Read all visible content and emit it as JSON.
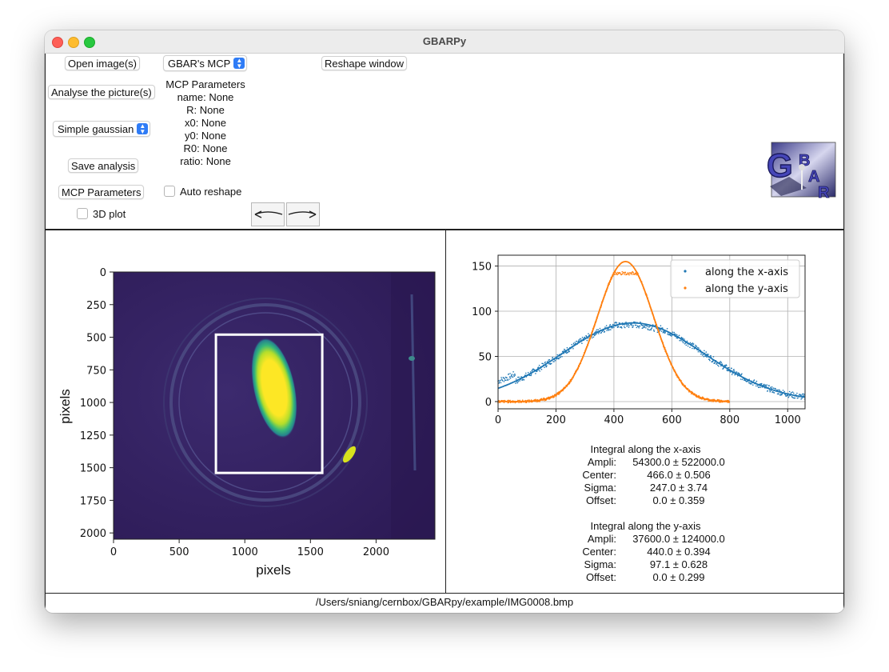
{
  "window": {
    "title": "GBARPy"
  },
  "controls": {
    "open_images": "Open image(s)",
    "analyse": "Analyse the picture(s)",
    "fit_mode": "Simple gaussian",
    "save_analysis": "Save analysis",
    "mcp_parameters": "MCP Parameters",
    "plot_3d": "3D plot",
    "mcp_select": "GBAR's MCP",
    "auto_reshape": "Auto reshape",
    "reshape_window": "Reshape window"
  },
  "mcp_params": {
    "title": "MCP Parameters",
    "lines": [
      "name: None",
      "R: None",
      "x0: None",
      "y0: None",
      "R0: None",
      "ratio: None"
    ]
  },
  "logo": {
    "letters": [
      "G",
      "B",
      "A",
      "R"
    ]
  },
  "image_plot": {
    "xlabel": "pixels",
    "ylabel": "pixels",
    "xticks": [
      "0",
      "500",
      "1000",
      "1500",
      "2000"
    ],
    "yticks": [
      "0",
      "250",
      "500",
      "750",
      "1000",
      "1250",
      "1500",
      "1750",
      "2000"
    ],
    "colormap": "viridis",
    "roi_rectangle": {
      "x_range": [
        780,
        1590
      ],
      "y_range": [
        480,
        1540
      ],
      "color": "#ffffff"
    }
  },
  "chart_data": {
    "type": "scatter",
    "xlim": [
      0,
      1060
    ],
    "ylim": [
      -8,
      162
    ],
    "xticks": [
      0,
      200,
      400,
      600,
      800,
      1000
    ],
    "yticks": [
      0,
      50,
      100,
      150
    ],
    "grid": true,
    "legend_position": "top-right",
    "series": [
      {
        "name": "along the x-axis",
        "color": "#1f77b4",
        "x_range": [
          0,
          1060
        ],
        "amplitude": 87,
        "center": 466,
        "sigma": 247,
        "offset": 0
      },
      {
        "name": "along the y-axis",
        "color": "#ff7f0e",
        "x_range": [
          0,
          800
        ],
        "amplitude": 155,
        "center": 440,
        "sigma": 97.1,
        "offset": 0
      }
    ]
  },
  "results": {
    "x": {
      "title": "Integral along the x-axis",
      "rows": [
        {
          "label": "Ampli:",
          "value": "54300.0 ± 522000.0"
        },
        {
          "label": "Center:",
          "value": "466.0 ± 0.506"
        },
        {
          "label": "Sigma:",
          "value": "247.0 ± 3.74"
        },
        {
          "label": "Offset:",
          "value": "0.0 ± 0.359"
        }
      ]
    },
    "y": {
      "title": "Integral along the y-axis",
      "rows": [
        {
          "label": "Ampli:",
          "value": "37600.0 ± 124000.0"
        },
        {
          "label": "Center:",
          "value": "440.0 ± 0.394"
        },
        {
          "label": "Sigma:",
          "value": "97.1 ± 0.628"
        },
        {
          "label": "Offset:",
          "value": "0.0 ± 0.299"
        }
      ]
    }
  },
  "status": {
    "path": "/Users/sniang/cernbox/GBARpy/example/IMG0008.bmp"
  }
}
